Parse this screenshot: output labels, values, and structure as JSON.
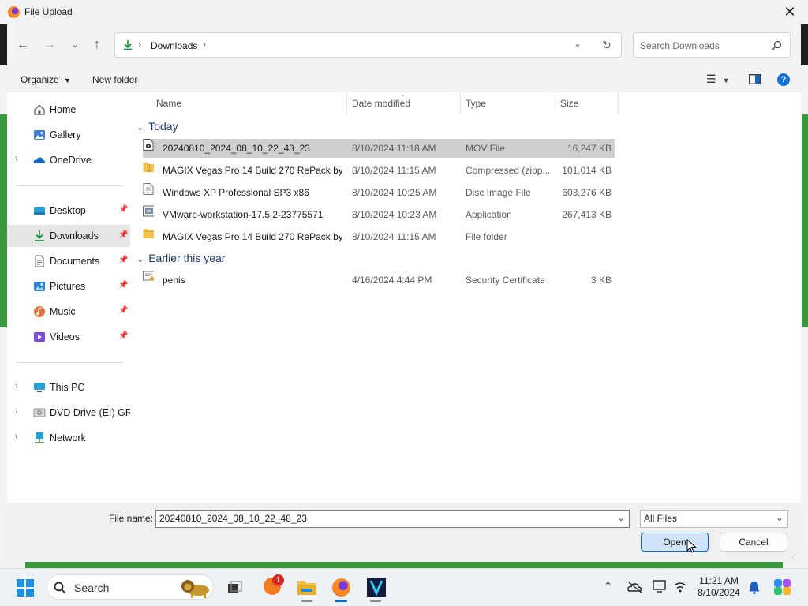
{
  "window": {
    "title": "File Upload"
  },
  "nav": {
    "address_label": "Downloads",
    "search_placeholder": "Search Downloads"
  },
  "toolbar": {
    "organize_label": "Organize",
    "new_folder_label": "New folder"
  },
  "sidebar": {
    "items": [
      {
        "label": "Home"
      },
      {
        "label": "Gallery"
      },
      {
        "label": "OneDrive"
      },
      {
        "label": "Desktop"
      },
      {
        "label": "Downloads"
      },
      {
        "label": "Documents"
      },
      {
        "label": "Pictures"
      },
      {
        "label": "Music"
      },
      {
        "label": "Videos"
      },
      {
        "label": "This PC"
      },
      {
        "label": "DVD Drive (E:) GRTM"
      },
      {
        "label": "Network"
      }
    ]
  },
  "columns": {
    "name": "Name",
    "date": "Date modified",
    "type": "Type",
    "size": "Size"
  },
  "groups": [
    {
      "label": "Today",
      "files": [
        {
          "name": "20240810_2024_08_10_22_48_23",
          "date": "8/10/2024 11:18 AM",
          "type": "MOV File",
          "size": "16,247 KB",
          "icon": "video-file-icon"
        },
        {
          "name": "MAGIX Vegas Pro 14 Build 270 RePack by ...",
          "date": "8/10/2024 11:15 AM",
          "type": "Compressed (zipp...",
          "size": "101,014 KB",
          "icon": "zip-folder-icon"
        },
        {
          "name": "Windows XP Professional SP3 x86",
          "date": "8/10/2024 10:25 AM",
          "type": "Disc Image File",
          "size": "603,276 KB",
          "icon": "disc-image-icon"
        },
        {
          "name": "VMware-workstation-17.5.2-23775571",
          "date": "8/10/2024 10:23 AM",
          "type": "Application",
          "size": "267,413 KB",
          "icon": "application-icon"
        },
        {
          "name": "MAGIX Vegas Pro 14 Build 270 RePack by ...",
          "date": "8/10/2024 11:15 AM",
          "type": "File folder",
          "size": "",
          "icon": "folder-icon"
        }
      ]
    },
    {
      "label": "Earlier this year",
      "files": [
        {
          "name": "penis",
          "date": "4/16/2024 4:44 PM",
          "type": "Security Certificate",
          "size": "3 KB",
          "icon": "certificate-icon"
        }
      ]
    }
  ],
  "bottom": {
    "file_name_label": "File name:",
    "file_name_value": "20240810_2024_08_10_22_48_23",
    "file_type_value": "All Files",
    "open_label": "Open",
    "cancel_label": "Cancel"
  },
  "taskbar": {
    "search_label": "Search",
    "notification_badge": "1",
    "time": "11:21 AM",
    "date": "8/10/2024"
  },
  "colors": {
    "accent": "#0067c0",
    "selection": "#cfcfcf",
    "group_header": "#1f3b6e",
    "green": "#3a9a3a"
  }
}
